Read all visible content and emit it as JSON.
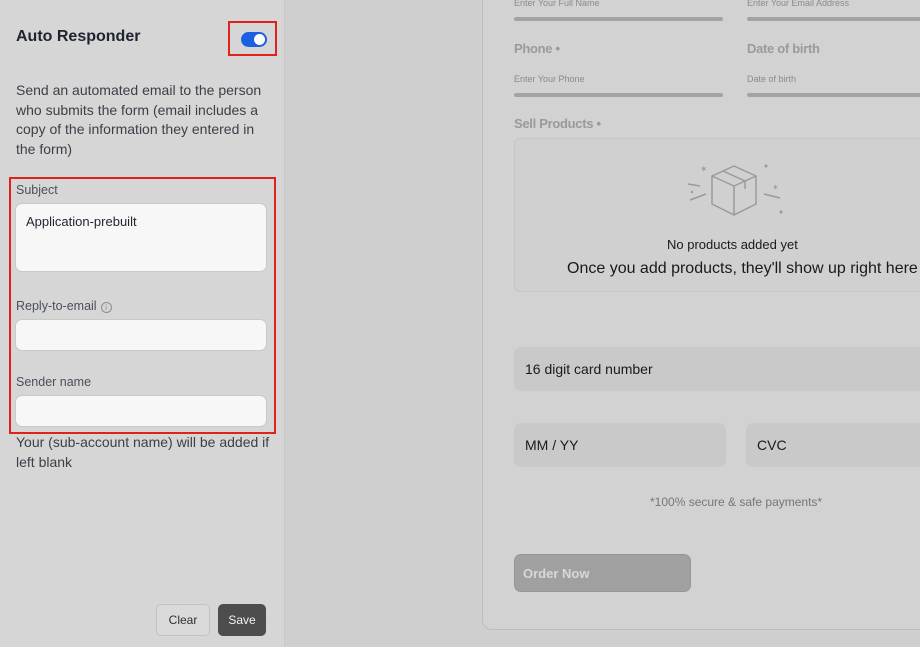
{
  "settings": {
    "title": "Auto Responder",
    "toggle_on": true,
    "toggle_color": "#1c5fe0",
    "description": "Send an automated email to the person who submits the form (email includes a copy of the information they entered in the form)",
    "subject_label": "Subject",
    "subject_value": "Application-prebuilt",
    "reply_label": "Reply-to-email",
    "reply_value": "",
    "sender_label": "Sender name",
    "sender_value": "",
    "hint": "Your (sub-account name) will be added if left blank",
    "clear_label": "Clear",
    "save_label": "Save"
  },
  "preview": {
    "fullname_placeholder": "Enter Your Full Name",
    "email_placeholder": "Enter Your Email Address",
    "phone_label": "Phone",
    "phone_placeholder": "Enter Your Phone",
    "dob_label": "Date of birth",
    "dob_placeholder": "Date of birth",
    "required_mark": "•",
    "products_label": "Sell Products",
    "no_products_title": "No products added yet",
    "no_products_sub": "Once you add products, they'll show up right here",
    "card_placeholder": "16 digit card number",
    "expiry_placeholder": "MM / YY",
    "cvc_placeholder": "CVC",
    "secure_text": "*100% secure & safe payments*",
    "order_label": "Order Now"
  }
}
